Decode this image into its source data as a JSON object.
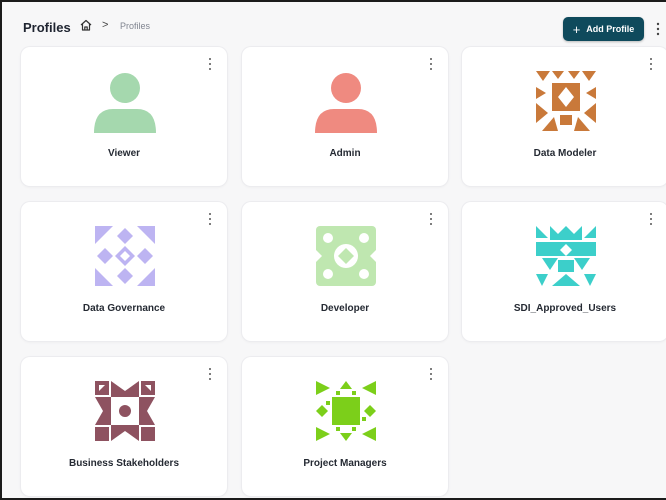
{
  "header": {
    "title": "Profiles",
    "breadcrumb_separator": ">",
    "breadcrumb_current": "Profiles",
    "add_button_label": "Add Profile",
    "add_button_icon": "plus-icon",
    "accent_color": "#0f4a5c"
  },
  "profiles": [
    {
      "name": "Viewer",
      "icon": "person-avatar-icon",
      "color": "#a5d8ae"
    },
    {
      "name": "Admin",
      "icon": "person-avatar-icon",
      "color": "#ef8a80"
    },
    {
      "name": "Data Modeler",
      "icon": "geometric-pattern-icon",
      "color": "#c9793a"
    },
    {
      "name": "Data Governance",
      "icon": "geometric-pattern-icon",
      "color": "#bdb4f2"
    },
    {
      "name": "Developer",
      "icon": "geometric-pattern-icon",
      "color": "#bfe7b0"
    },
    {
      "name": "SDI_Approved_Users",
      "icon": "geometric-pattern-icon",
      "color": "#3ccfca"
    },
    {
      "name": "Business Stakeholders",
      "icon": "geometric-pattern-icon",
      "color": "#8e5260"
    },
    {
      "name": "Project Managers",
      "icon": "geometric-pattern-icon",
      "color": "#7ccf1a"
    }
  ]
}
